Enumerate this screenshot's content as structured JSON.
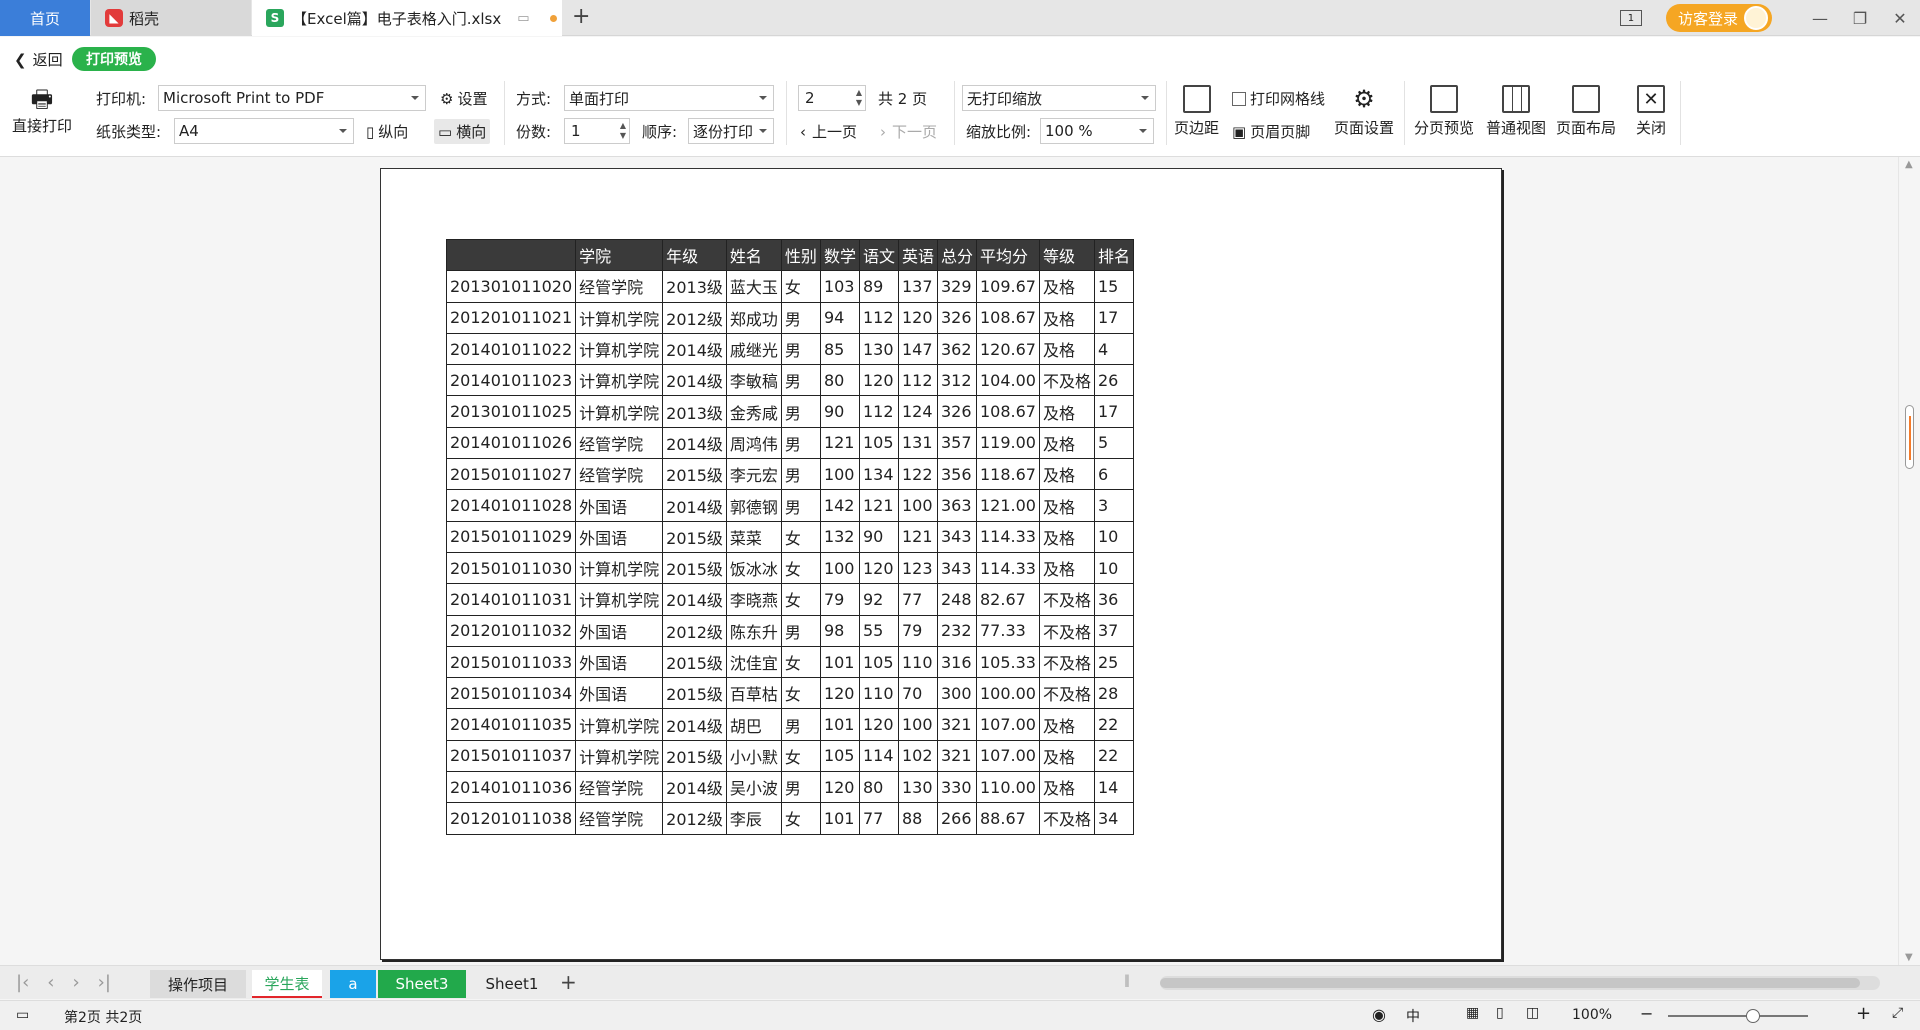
{
  "tabs": {
    "home": "首页",
    "daoke": "稻壳",
    "file": "【Excel篇】电子表格入门.xlsx",
    "login": "访客登录"
  },
  "toolbar": {
    "back": "返回",
    "preview": "打印预览",
    "direct_print": "直接打印",
    "printer_label": "打印机:",
    "printer_value": "Microsoft Print to PDF",
    "settings": "设置",
    "paper_label": "纸张类型:",
    "paper_value": "A4",
    "portrait": "纵向",
    "landscape": "横向",
    "mode_label": "方式:",
    "mode_value": "单面打印",
    "copies_label": "份数:",
    "copies_value": "1",
    "order_label": "顺序:",
    "order_value": "逐份打印",
    "page_value": "2",
    "total_pages": "共 2 页",
    "prev_page": "上一页",
    "next_page": "下一页",
    "scale_mode": "无打印缩放",
    "scale_label": "缩放比例:",
    "scale_value": "100 %",
    "margins": "页边距",
    "gridlines": "打印网格线",
    "header_footer": "页眉页脚",
    "page_setup": "页面设置",
    "page_break": "分页预览",
    "normal_view": "普通视图",
    "page_layout": "页面布局",
    "close": "关闭"
  },
  "table": {
    "headers": [
      "",
      "学院",
      "年级",
      "姓名",
      "性别",
      "数学",
      "语文",
      "英语",
      "总分",
      "平均分",
      "等级",
      "排名"
    ],
    "rows": [
      [
        "201301011020",
        "经管学院",
        "2013级",
        "蓝大玉",
        "女",
        "103",
        "89",
        "137",
        "329",
        "109.67",
        "及格",
        "15"
      ],
      [
        "201201011021",
        "计算机学院",
        "2012级",
        "郑成功",
        "男",
        "94",
        "112",
        "120",
        "326",
        "108.67",
        "及格",
        "17"
      ],
      [
        "201401011022",
        "计算机学院",
        "2014级",
        "戚继光",
        "男",
        "85",
        "130",
        "147",
        "362",
        "120.67",
        "及格",
        "4"
      ],
      [
        "201401011023",
        "计算机学院",
        "2014级",
        "李敏稿",
        "男",
        "80",
        "120",
        "112",
        "312",
        "104.00",
        "不及格",
        "26"
      ],
      [
        "201301011025",
        "计算机学院",
        "2013级",
        "金秀咸",
        "男",
        "90",
        "112",
        "124",
        "326",
        "108.67",
        "及格",
        "17"
      ],
      [
        "201401011026",
        "经管学院",
        "2014级",
        "周鸿伟",
        "男",
        "121",
        "105",
        "131",
        "357",
        "119.00",
        "及格",
        "5"
      ],
      [
        "201501011027",
        "经管学院",
        "2015级",
        "李元宏",
        "男",
        "100",
        "134",
        "122",
        "356",
        "118.67",
        "及格",
        "6"
      ],
      [
        "201401011028",
        "外国语",
        "2014级",
        "郭德钢",
        "男",
        "142",
        "121",
        "100",
        "363",
        "121.00",
        "及格",
        "3"
      ],
      [
        "201501011029",
        "外国语",
        "2015级",
        "菜菜",
        "女",
        "132",
        "90",
        "121",
        "343",
        "114.33",
        "及格",
        "10"
      ],
      [
        "201501011030",
        "计算机学院",
        "2015级",
        "饭冰冰",
        "女",
        "100",
        "120",
        "123",
        "343",
        "114.33",
        "及格",
        "10"
      ],
      [
        "201401011031",
        "计算机学院",
        "2014级",
        "李晓燕",
        "女",
        "79",
        "92",
        "77",
        "248",
        "82.67",
        "不及格",
        "36"
      ],
      [
        "201201011032",
        "外国语",
        "2012级",
        "陈东升",
        "男",
        "98",
        "55",
        "79",
        "232",
        "77.33",
        "不及格",
        "37"
      ],
      [
        "201501011033",
        "外国语",
        "2015级",
        "沈佳宜",
        "女",
        "101",
        "105",
        "110",
        "316",
        "105.33",
        "不及格",
        "25"
      ],
      [
        "201501011034",
        "外国语",
        "2015级",
        "百草枯",
        "女",
        "120",
        "110",
        "70",
        "300",
        "100.00",
        "不及格",
        "28"
      ],
      [
        "201401011035",
        "计算机学院",
        "2014级",
        "胡巴",
        "男",
        "101",
        "120",
        "100",
        "321",
        "107.00",
        "及格",
        "22"
      ],
      [
        "201501011037",
        "计算机学院",
        "2015级",
        "小小默",
        "女",
        "105",
        "114",
        "102",
        "321",
        "107.00",
        "及格",
        "22"
      ],
      [
        "201401011036",
        "经管学院",
        "2014级",
        "吴小波",
        "男",
        "120",
        "80",
        "130",
        "330",
        "110.00",
        "及格",
        "14"
      ],
      [
        "201201011038",
        "经管学院",
        "2012级",
        "李辰",
        "女",
        "101",
        "77",
        "88",
        "266",
        "88.67",
        "不及格",
        "34"
      ]
    ]
  },
  "sheets": {
    "tab1": "操作项目",
    "tab2": "学生表",
    "tab3": "a",
    "tab4": "Sheet3",
    "tab5": "Sheet1"
  },
  "status": {
    "page_info": "第2页 共2页",
    "input_mode": "中",
    "zoom": "100%"
  },
  "colors": {
    "accent": "#3b7ed9",
    "preview_green": "#2ab24b",
    "login_orange": "#f5a623",
    "sheet_active_underline": "#e2262b",
    "sheet_a": "#1aa3e8",
    "sheet3_green": "#22a94b"
  }
}
